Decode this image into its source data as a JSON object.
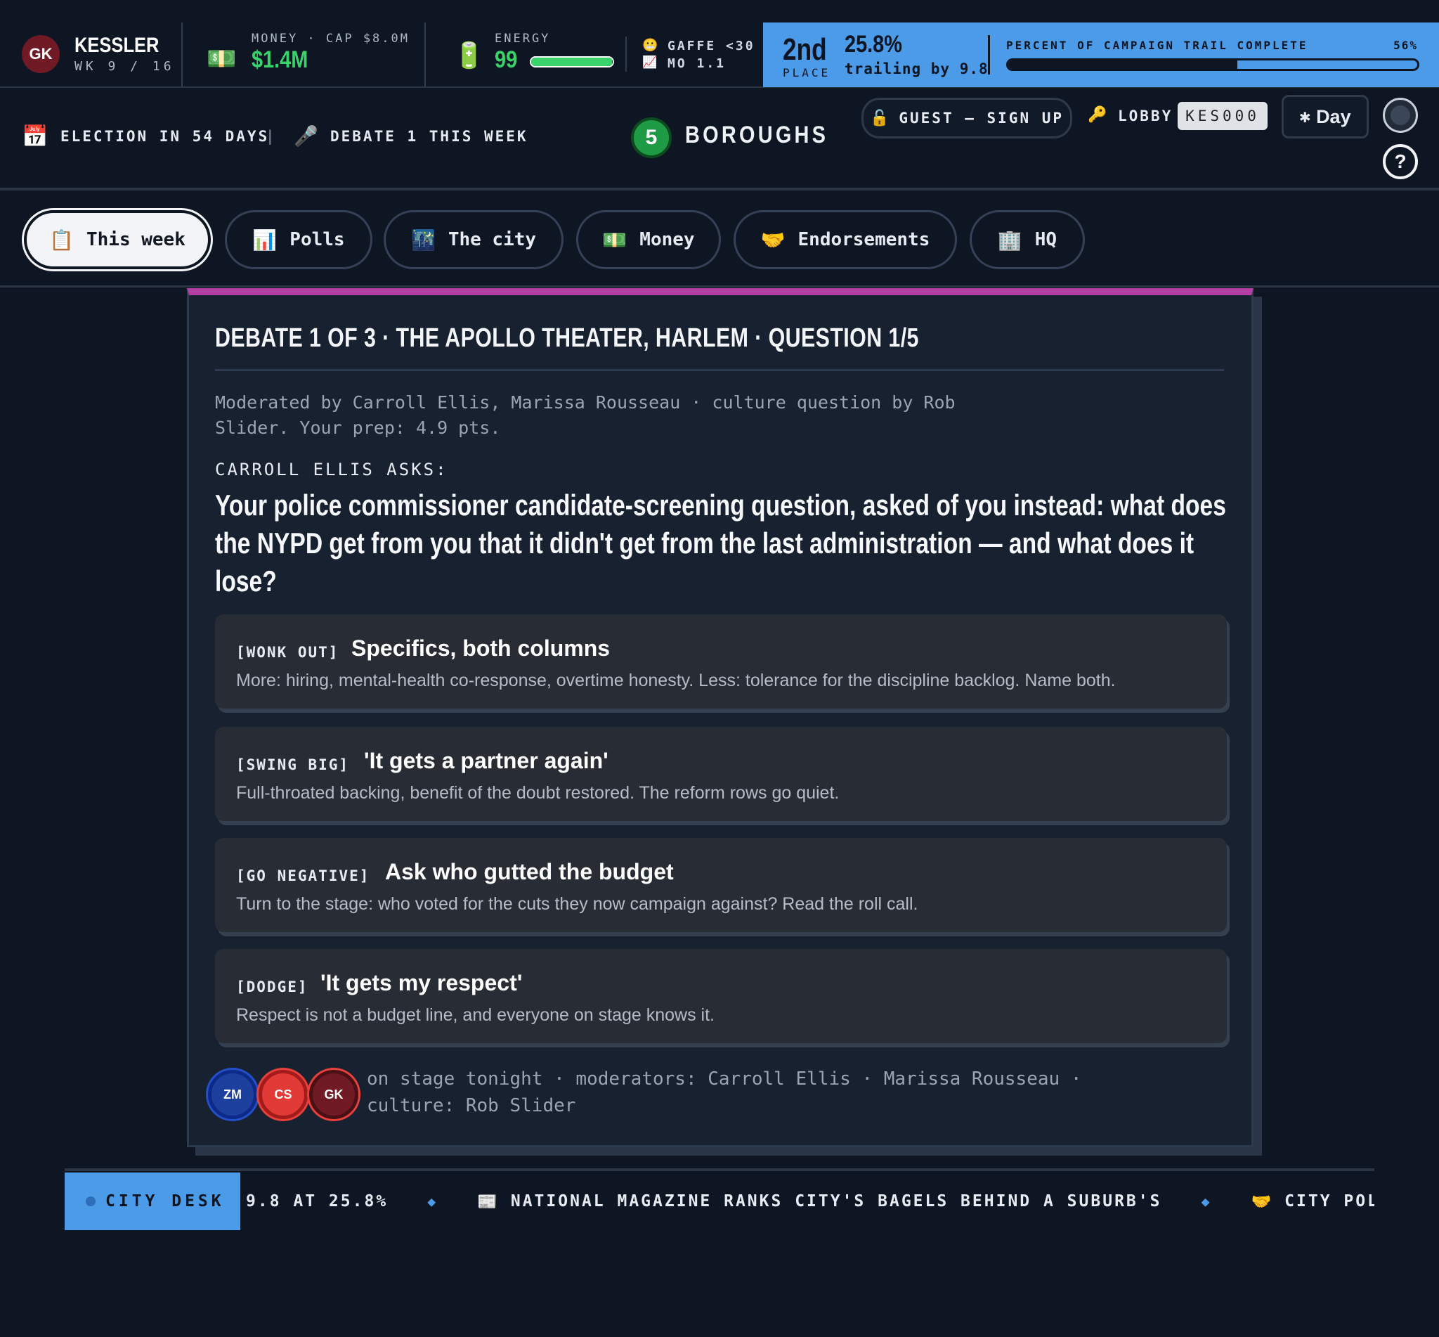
{
  "player": {
    "initials": "GK",
    "name": "KESSLER",
    "week": "WK 9 / 16"
  },
  "money": {
    "label": "MONEY · CAP $8.0M",
    "value": "$1.4M"
  },
  "energy": {
    "label": "ENERGY",
    "value": "99",
    "level_pct": 99
  },
  "risk": {
    "gaffe": "GAFFE <30",
    "mo": "MO 1.1"
  },
  "standing": {
    "place": "2nd",
    "place_label": "PLACE",
    "pct": "25.8%",
    "trailing": "trailing by 9.8"
  },
  "trail": {
    "label": "PERCENT OF CAMPAIGN TRAIL COMPLETE",
    "pct_text": "56%",
    "fraction": 0.56
  },
  "subbar": {
    "election": "ELECTION IN 54 DAYS",
    "sep": "|",
    "debate": "DEBATE 1 THIS WEEK",
    "logo_number": "5",
    "logo_text": "BOROUGHS",
    "guest_btn": "GUEST — SIGN UP",
    "lobby_label": "LOBBY",
    "lobby_code": "KES000",
    "day_btn": "Day",
    "help": "?"
  },
  "tabs": [
    {
      "icon": "📋",
      "label": "This week",
      "active": true
    },
    {
      "icon": "📊",
      "label": "Polls"
    },
    {
      "icon": "🌃",
      "label": "The city"
    },
    {
      "icon": "💵",
      "label": "Money"
    },
    {
      "icon": "🤝",
      "label": "Endorsements"
    },
    {
      "icon": "🏢",
      "label": "HQ"
    }
  ],
  "debate": {
    "title": "DEBATE 1 OF 3 · THE APOLLO THEATER, HARLEM · QUESTION 1/5",
    "meta": "Moderated by Carroll Ellis, Marissa Rousseau · culture question by Rob Slider. Your prep: 4.9 pts.",
    "asker": "CARROLL ELLIS ASKS:",
    "question": "Your police commissioner candidate-screening question, asked of you instead: what does the NYPD get from you that it didn't get from the last administration — and what does it lose?",
    "options": [
      {
        "tag": "[WONK OUT]",
        "title": "Specifics, both columns",
        "desc": "More: hiring, mental-health co-response, overtime honesty. Less: tolerance for the discipline backlog. Name both."
      },
      {
        "tag": "[SWING BIG]",
        "title": "'It gets a partner again'",
        "desc": "Full-throated backing, benefit of the doubt restored. The reform rows go quiet."
      },
      {
        "tag": "[GO NEGATIVE]",
        "title": "Ask who gutted the budget",
        "desc": "Turn to the stage: who voted for the cuts they now campaign against? Read the roll call."
      },
      {
        "tag": "[DODGE]",
        "title": "'It gets my respect'",
        "desc": "Respect is not a budget line, and everyone on stage knows it."
      }
    ],
    "stage": {
      "chips": [
        "ZM",
        "CS",
        "GK"
      ],
      "text": "on stage tonight · moderators: Carroll Ellis · Marissa Rousseau · culture: Rob Slider"
    }
  },
  "ticker": {
    "label": "CITY DESK",
    "items": [
      {
        "icon": "",
        "text": "9.8 AT 25.8%"
      },
      {
        "icon": "📰",
        "text": "NATIONAL MAGAZINE RANKS CITY'S BAGELS BEHIND A SUBURB'S"
      },
      {
        "icon": "🤝",
        "text": "CITY POLICE BRO"
      }
    ]
  },
  "colors": {
    "accent_blue": "#4c9be8",
    "accent_green": "#39d26b",
    "debate_stripe": "#b33ea4",
    "bg": "#0f1623"
  }
}
